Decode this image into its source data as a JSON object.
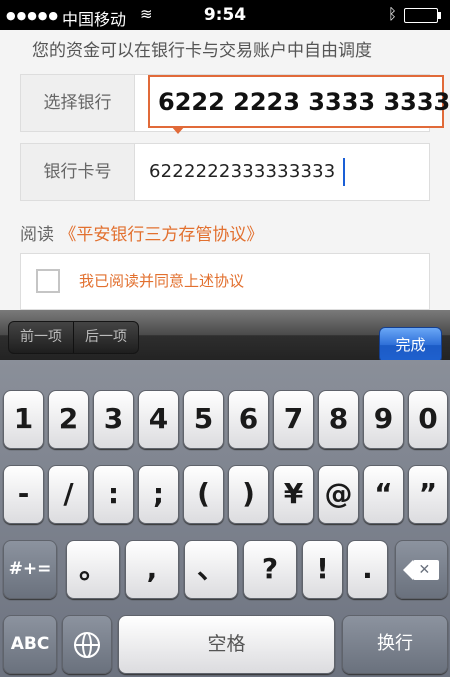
{
  "status_bar": {
    "carrier": "中国移动",
    "time": "9:54"
  },
  "form": {
    "notice": "您的资金可以在银行卡与交易账户中自由调度",
    "select_bank_label": "选择银行",
    "card_number_label": "银行卡号",
    "card_number_value": "6222222333333333",
    "card_number_preview": "6222 2223 3333 3333",
    "read_prefix": "阅读",
    "agreement_link": "《平安银行三方存管协议》",
    "agree_checkbox_label": "我已阅读并同意上述协议"
  },
  "toolbar": {
    "prev": "前一项",
    "next": "后一项",
    "done": "完成"
  },
  "keyboard": {
    "row1": [
      "1",
      "2",
      "3",
      "4",
      "5",
      "6",
      "7",
      "8",
      "9",
      "0"
    ],
    "row2": [
      "-",
      "/",
      ":",
      ";",
      "(",
      ")",
      "¥",
      "@",
      "“",
      "”"
    ],
    "row3_mode": "#+=",
    "row3": [
      "。",
      ",",
      "、",
      "?",
      "!",
      "."
    ],
    "abc": "ABC",
    "space": "空格",
    "return": "换行"
  }
}
